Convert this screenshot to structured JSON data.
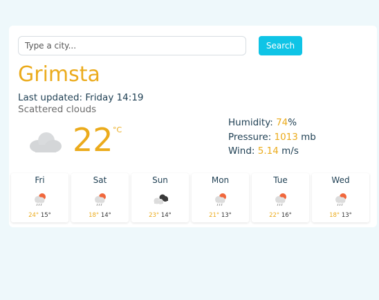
{
  "search": {
    "placeholder": "Type a city...",
    "button_label": "Search"
  },
  "current": {
    "city": "Grimsta",
    "updated": "Last updated: Friday 14:19",
    "description": "Scattered clouds",
    "icon": "cloud-icon",
    "temperature": "22",
    "unit": "°C",
    "humidity_label": "Humidity: ",
    "humidity_value": "74",
    "humidity_unit": "%",
    "pressure_label": "Pressure: ",
    "pressure_value": "1013",
    "pressure_unit": " mb",
    "wind_label": "Wind: ",
    "wind_value": "5.14",
    "wind_unit": " m/s"
  },
  "forecast": [
    {
      "day": "Fri",
      "icon": "sun-rain-icon",
      "high": "24°",
      "low": "15°"
    },
    {
      "day": "Sat",
      "icon": "sun-rain-icon",
      "high": "18°",
      "low": "14°"
    },
    {
      "day": "Sun",
      "icon": "broken-clouds-icon",
      "high": "23°",
      "low": "14°"
    },
    {
      "day": "Mon",
      "icon": "sun-rain-icon",
      "high": "21°",
      "low": "13°"
    },
    {
      "day": "Tue",
      "icon": "sun-rain-icon",
      "high": "22°",
      "low": "16°"
    },
    {
      "day": "Wed",
      "icon": "sun-rain-icon",
      "high": "18°",
      "low": "13°"
    }
  ],
  "colors": {
    "accent": "#ebab1c",
    "button": "#0fc4e6",
    "text_dark": "#1d3e52",
    "background": "#eef8fb"
  }
}
